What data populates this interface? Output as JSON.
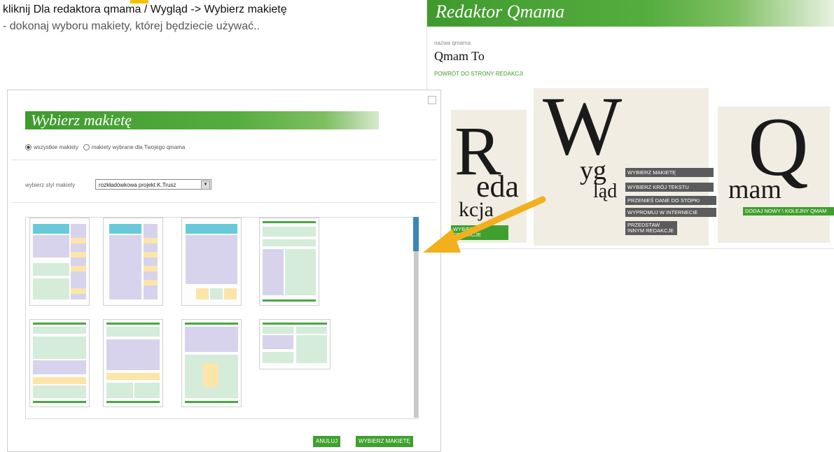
{
  "instruction": {
    "line1": "kliknij Dla redaktora qmama / Wygląd -> Wybierz makietę",
    "line2": "- dokonaj wyboru makiety, której będziecie używać.."
  },
  "editor": {
    "banner": "Redaktor Qmama",
    "name_label": "nazwa qmama",
    "name_value": "Qmam To",
    "back_link": "POWRÓT DO STRONY REDAKCJI",
    "big_r": "R",
    "eda": "eda",
    "kcja": "kcja",
    "big_w": "W",
    "yg": "yg",
    "lad": "ląd",
    "big_q": "Q",
    "mam": "mam",
    "menu": [
      "WYBIERZ MAKIETĘ",
      "WYBIERZ KRÓJ TEKSTU",
      "PRZENIEŚ DANE DO STOPKI",
      "WYPROMUJ W INTERNECIE",
      "PRZEDSTAW INNYM REDAKCJE"
    ],
    "green_redakcje": "WYBIERZ REDAKCJE",
    "green_dodaj": "DODAJ NOWY \\ KOLEJNY QMAM"
  },
  "modal": {
    "title": "Wybierz makietę",
    "radio_all": "wszystkie makiety",
    "radio_selected": "makiety wybrane dla Twojego qmama",
    "style_label": "wybierz styl makiety",
    "style_value": "rozkładówkowa projekt K.Trusz",
    "cancel": "ANULUJ",
    "choose": "WYBIERZ MAKIETĘ"
  },
  "colors": {
    "brand_green": "#3fa02e",
    "arrow": "#f2b01e",
    "scroll_thumb": "#3b87b6"
  }
}
